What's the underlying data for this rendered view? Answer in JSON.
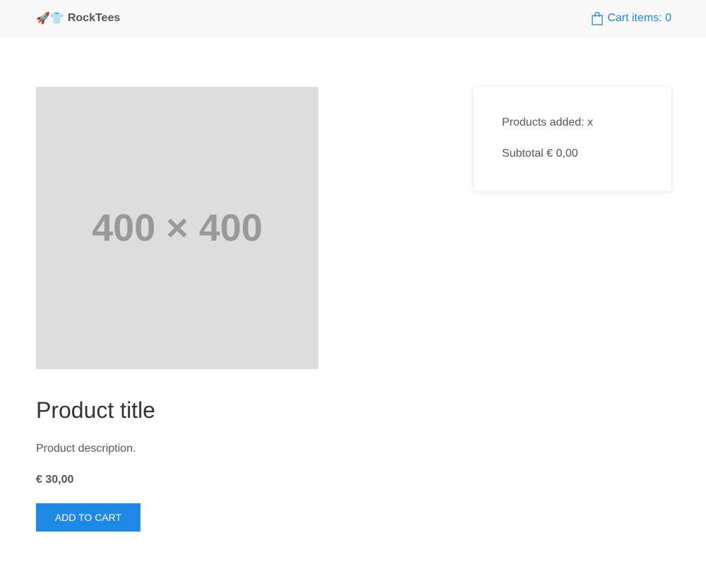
{
  "header": {
    "brand_emoji": "🚀👕",
    "brand_name": "RockTees",
    "cart_label": "Cart items: 0",
    "cart_icon": "shopping-bag-icon",
    "accent_color": "#1e88e5"
  },
  "product": {
    "image_placeholder": "400 × 400",
    "title": "Product title",
    "description": "Product description.",
    "price": "€ 30,00",
    "add_button_label": "ADD TO CART"
  },
  "summary": {
    "products_added": "Products added: x",
    "subtotal": "Subtotal € 0,00"
  }
}
